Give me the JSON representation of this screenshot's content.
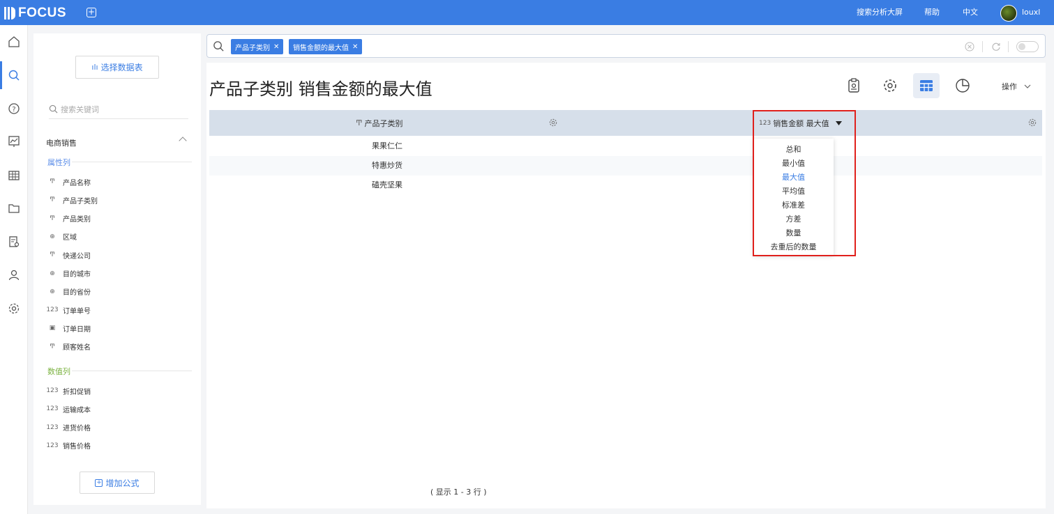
{
  "app": {
    "logo_text": "FOCUS"
  },
  "topnav": {
    "screen": "搜索分析大屏",
    "help": "帮助",
    "lang": "中文",
    "user": "louxl"
  },
  "rail": [
    "home-icon",
    "search-icon",
    "question-icon",
    "dashboard-icon",
    "table-icon",
    "folder-icon",
    "report-settings-icon",
    "user-icon",
    "gear-icon"
  ],
  "sidebar": {
    "select_table_label": "选择数据表",
    "search_placeholder": "搜索关键词",
    "group_title": "电商销售",
    "attr_section": "属性列",
    "attr_fields": [
      {
        "label": "产品名称",
        "type": "text"
      },
      {
        "label": "产品子类别",
        "type": "text"
      },
      {
        "label": "产品类别",
        "type": "text"
      },
      {
        "label": "区域",
        "type": "geo"
      },
      {
        "label": "快递公司",
        "type": "text"
      },
      {
        "label": "目的城市",
        "type": "geo"
      },
      {
        "label": "目的省份",
        "type": "geo"
      },
      {
        "label": "订单单号",
        "type": "number"
      },
      {
        "label": "订单日期",
        "type": "date"
      },
      {
        "label": "顾客姓名",
        "type": "text"
      }
    ],
    "num_section": "数值列",
    "num_fields": [
      {
        "label": "折扣促销",
        "type": "number"
      },
      {
        "label": "运输成本",
        "type": "number"
      },
      {
        "label": "进货价格",
        "type": "number"
      },
      {
        "label": "销售价格",
        "type": "number"
      }
    ],
    "add_formula_label": "增加公式"
  },
  "search": {
    "chips": [
      "产品子类别",
      "销售金额的最大值"
    ]
  },
  "main": {
    "title": "产品子类别 销售金额的最大值",
    "ops_label": "操作",
    "columns": [
      {
        "type_icon": "Ͳ",
        "label": "产品子类别"
      },
      {
        "type_icon": "123",
        "label": "销售金额 最大值"
      }
    ],
    "rows": [
      "果果仁仁",
      "特惠炒货",
      "磕壳坚果"
    ],
    "agg_menu": [
      "总和",
      "最小值",
      "最大值",
      "平均值",
      "标准差",
      "方差",
      "数量",
      "去重后的数量"
    ],
    "agg_selected": "最大值",
    "pager": "( 显示 1 - 3 行 )"
  },
  "colors": {
    "brand": "#3a7de3",
    "highlight": "#e0201c",
    "header_bg": "#d6dfea",
    "attr_section": "#5b8de8",
    "num_section": "#7cb342"
  }
}
